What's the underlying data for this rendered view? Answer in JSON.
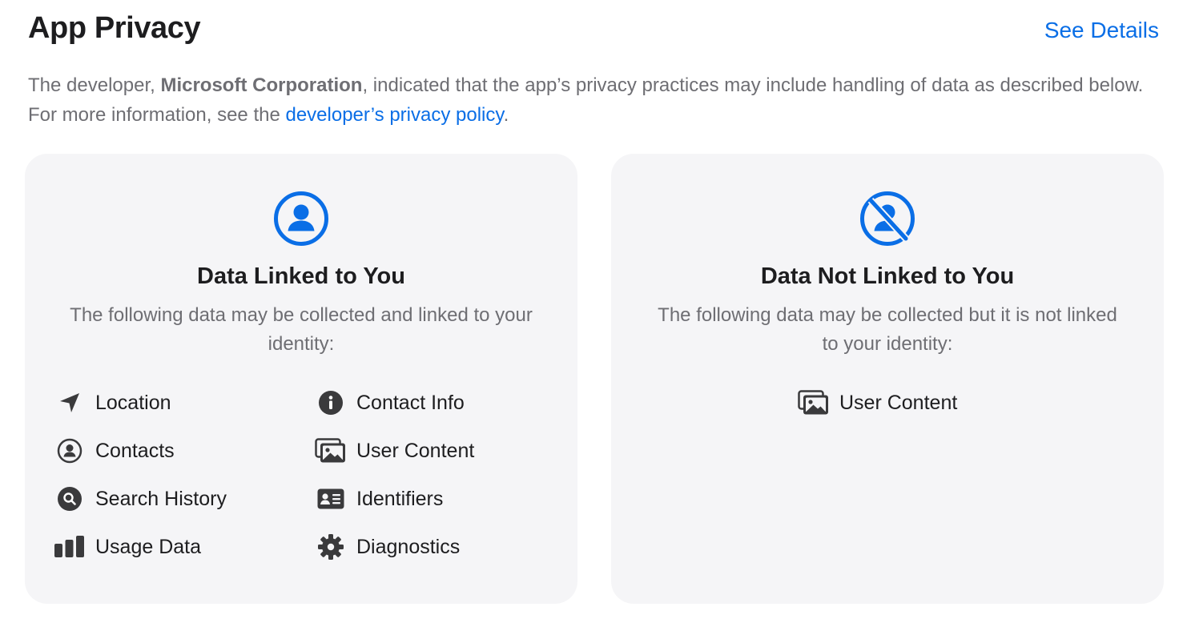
{
  "header": {
    "title": "App Privacy",
    "see_details": "See Details"
  },
  "intro": {
    "text_before": "The developer, ",
    "developer": "Microsoft Corporation",
    "text_middle": ", indicated that the app’s privacy practices may include handling of data as described below. For more information, see the ",
    "link": "developer’s privacy policy",
    "text_after": "."
  },
  "linked": {
    "icon": "person-circle-icon",
    "title": "Data Linked to You",
    "description": "The following data may be collected and linked to your identity:",
    "items": [
      {
        "label": "Location",
        "icon": "location-arrow-icon"
      },
      {
        "label": "Contact Info",
        "icon": "info-circle-icon"
      },
      {
        "label": "Contacts",
        "icon": "person-circle-icon"
      },
      {
        "label": "User Content",
        "icon": "photos-icon"
      },
      {
        "label": "Search History",
        "icon": "magnifier-circle-icon"
      },
      {
        "label": "Identifiers",
        "icon": "id-card-icon"
      },
      {
        "label": "Usage Data",
        "icon": "bar-chart-icon"
      },
      {
        "label": "Diagnostics",
        "icon": "gear-icon"
      }
    ]
  },
  "not_linked": {
    "icon": "person-crossed-circle-icon",
    "title": "Data Not Linked to You",
    "description": "The following data may be collected but it is not linked to your identity:",
    "items": [
      {
        "label": "User Content",
        "icon": "photos-icon"
      }
    ]
  },
  "colors": {
    "accent": "#0a6ee6",
    "icon": "#3a3a3c",
    "card": "#f5f5f7",
    "secondary_text": "#6e6e73"
  }
}
